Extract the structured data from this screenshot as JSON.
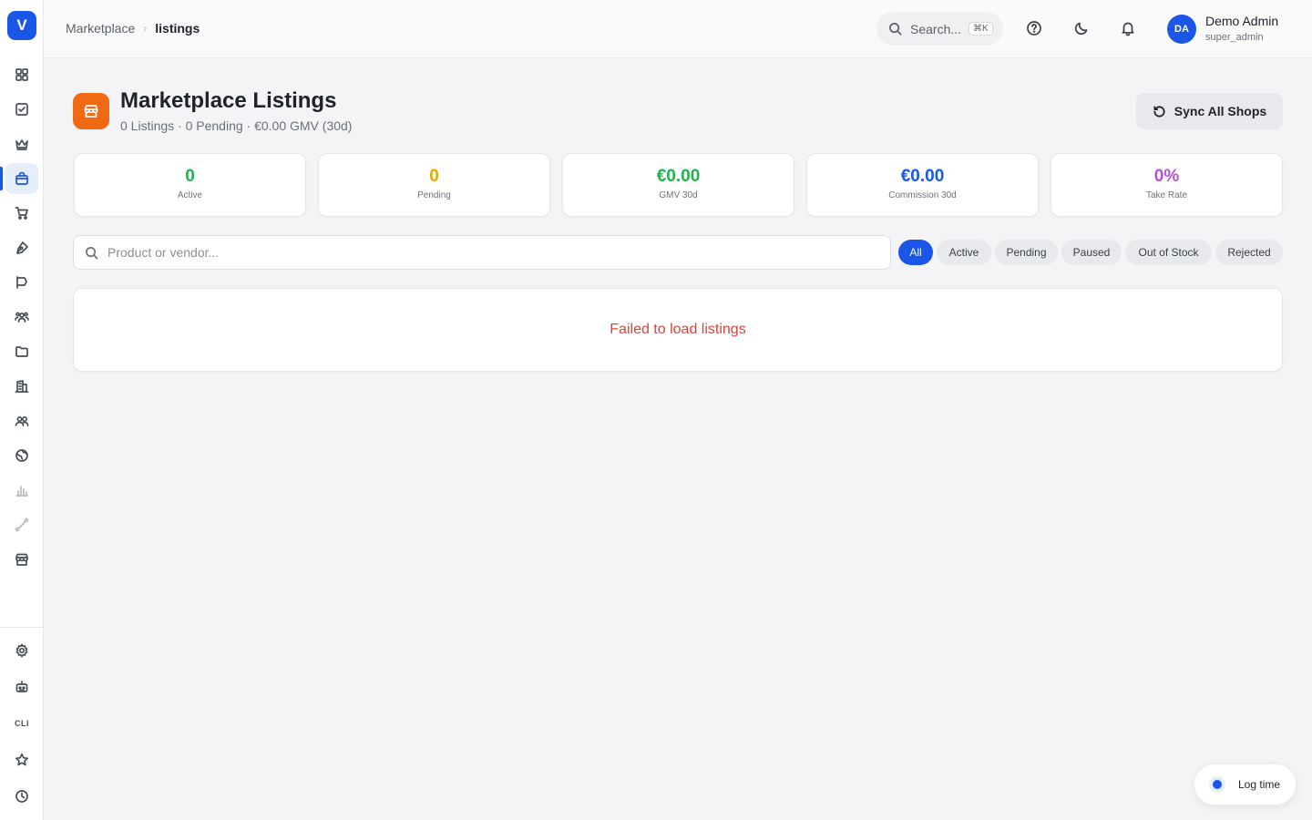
{
  "logo": {
    "letter": "V"
  },
  "sidebar": {
    "items": [
      {
        "icon": "grid-icon",
        "name": "dashboard"
      },
      {
        "icon": "checkbox-icon",
        "name": "tasks"
      },
      {
        "icon": "crown-icon",
        "name": "premium"
      },
      {
        "icon": "shopping-bag-icon",
        "name": "marketplace",
        "active": true
      },
      {
        "icon": "cart-icon",
        "name": "orders"
      },
      {
        "icon": "pen-nib-icon",
        "name": "content"
      },
      {
        "icon": "flag-icon",
        "name": "campaigns"
      },
      {
        "icon": "users-group-icon",
        "name": "teams"
      },
      {
        "icon": "folder-icon",
        "name": "files"
      },
      {
        "icon": "building-icon",
        "name": "companies"
      },
      {
        "icon": "people-icon",
        "name": "contacts"
      },
      {
        "icon": "globe-icon",
        "name": "web"
      },
      {
        "icon": "bar-chart-icon",
        "name": "analytics",
        "muted": true
      },
      {
        "icon": "route-icon",
        "name": "workflows",
        "muted": true
      },
      {
        "icon": "store-icon",
        "name": "stores"
      }
    ],
    "bottom": [
      {
        "icon": "gear-icon",
        "name": "settings"
      },
      {
        "icon": "robot-icon",
        "name": "assistant"
      },
      {
        "icon": "cli-icon",
        "name": "cli",
        "label": "CLI"
      },
      {
        "icon": "star-icon",
        "name": "favorites"
      },
      {
        "icon": "clock-icon",
        "name": "history"
      }
    ]
  },
  "header": {
    "breadcrumb": {
      "root": "Marketplace",
      "current": "listings"
    },
    "search": {
      "placeholder": "Search...",
      "shortcut": "⌘K"
    },
    "user": {
      "initials": "DA",
      "name": "Demo Admin",
      "role": "super_admin"
    }
  },
  "page": {
    "title": "Marketplace Listings",
    "subtitle": "0 Listings · 0 Pending · €0.00 GMV (30d)",
    "sync_label": "Sync All Shops"
  },
  "stats": [
    {
      "value": "0",
      "label": "Active",
      "color": "#22b14c"
    },
    {
      "value": "0",
      "label": "Pending",
      "color": "#e0a800"
    },
    {
      "value": "€0.00",
      "label": "GMV 30d",
      "color": "#22b14c"
    },
    {
      "value": "€0.00",
      "label": "Commission 30d",
      "color": "#1a56e8"
    },
    {
      "value": "0%",
      "label": "Take Rate",
      "color": "#b24fdc"
    }
  ],
  "filters": {
    "search_placeholder": "Product or vendor...",
    "chips": [
      "All",
      "Active",
      "Pending",
      "Paused",
      "Out of Stock",
      "Rejected"
    ],
    "active_chip": "All"
  },
  "results": {
    "error": "Failed to load listings"
  },
  "log_time": {
    "label": "Log time"
  }
}
